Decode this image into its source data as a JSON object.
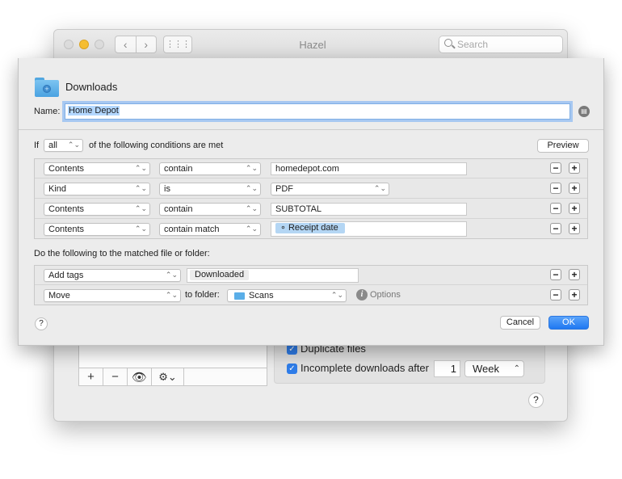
{
  "window": {
    "title": "Hazel",
    "search_placeholder": "Search",
    "nav_back": "‹",
    "nav_forward": "›",
    "grid_glyph": "⋮⋮⋮",
    "bottom_toolbar": [
      "+",
      "−",
      "👁",
      "⚙⌄"
    ],
    "options": {
      "duplicate_files": {
        "label": "Duplicate files",
        "checked": true
      },
      "incomplete_downloads": {
        "label": "Incomplete downloads after",
        "checked": true,
        "value": "1",
        "unit": "Week"
      }
    },
    "help": "?"
  },
  "sheet": {
    "folder_name": "Downloads",
    "folder_icon": "folder-icon",
    "name_label": "Name:",
    "name_value": "Home Depot",
    "if_label": "If",
    "match_mode": "all",
    "conditions_suffix": "of the following conditions are met",
    "preview_label": "Preview",
    "conditions": [
      {
        "attribute": "Contents",
        "operator": "contain",
        "value": "homedepot.com",
        "kind": "text"
      },
      {
        "attribute": "Kind",
        "operator": "is",
        "value": "PDF",
        "kind": "popup"
      },
      {
        "attribute": "Contents",
        "operator": "contain",
        "value": "SUBTOTAL",
        "kind": "text"
      },
      {
        "attribute": "Contents",
        "operator": "contain match",
        "value": "Receipt date",
        "kind": "token"
      }
    ],
    "actions_label": "Do the following to the matched file or folder:",
    "actions": [
      {
        "action": "Add tags",
        "tag": "Downloaded"
      },
      {
        "action": "Move",
        "to_folder_label": "to folder:",
        "folder": "Scans",
        "options_label": "Options"
      }
    ],
    "help": "?",
    "cancel_label": "Cancel",
    "ok_label": "OK",
    "plus": "+",
    "minus": "−",
    "accent_color": "#1f78f2"
  }
}
